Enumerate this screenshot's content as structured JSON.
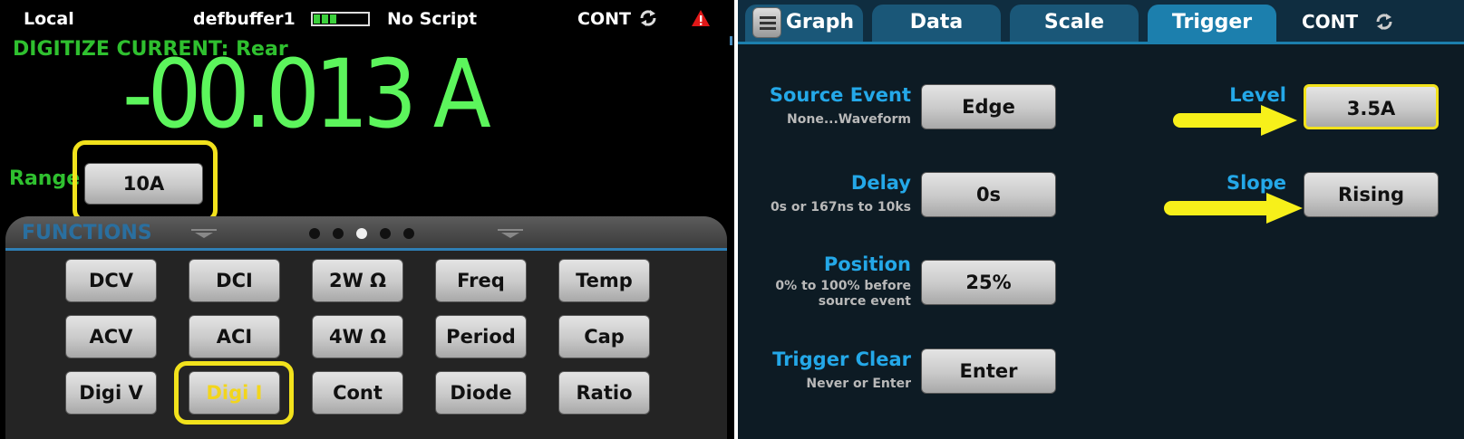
{
  "left": {
    "status": {
      "mode": "Local",
      "buffer_name": "defbuffer1",
      "buffer_fill": 0.45,
      "script": "No Script",
      "trigger_mode": "CONT"
    },
    "function_title": "DIGITIZE CURRENT: Rear",
    "reading": {
      "sign": "-",
      "value": "00.013 A"
    },
    "range": {
      "label": "Range",
      "value": "10A"
    },
    "functions_drawer": {
      "title": "FUNCTIONS",
      "page_count": 5,
      "active_page": 3,
      "buttons": [
        [
          "DCV",
          "DCI",
          "2W Ω",
          "Freq",
          "Temp"
        ],
        [
          "ACV",
          "ACI",
          "4W Ω",
          "Period",
          "Cap"
        ],
        [
          "Digi V",
          "Digi I",
          "Cont",
          "Diode",
          "Ratio"
        ]
      ],
      "selected": "Digi I"
    }
  },
  "right": {
    "tabs": [
      "Graph",
      "Data",
      "Scale",
      "Trigger"
    ],
    "active_tab": "Trigger",
    "trigger_mode": "CONT",
    "settings": {
      "source_event": {
        "label": "Source Event",
        "sub": "None...Waveform",
        "value": "Edge"
      },
      "delay": {
        "label": "Delay",
        "sub": "0s or 167ns to 10ks",
        "value": "0s"
      },
      "position": {
        "label": "Position",
        "sub_line1": "0% to 100% before",
        "sub_line2": "source event",
        "value": "25%"
      },
      "trigger_clear": {
        "label": "Trigger Clear",
        "sub": "Never or Enter",
        "value": "Enter"
      },
      "level": {
        "label": "Level",
        "value": "3.5A"
      },
      "slope": {
        "label": "Slope",
        "value": "Rising"
      }
    }
  },
  "colors": {
    "reading_green": "#5cf55c",
    "label_green": "#2fc02f",
    "highlight_yellow": "#f2e21c",
    "selected_text": "#f2d51c",
    "setting_blue": "#24a8e8",
    "tab_active": "#1c7fad",
    "tab_inactive": "#1a5778"
  }
}
